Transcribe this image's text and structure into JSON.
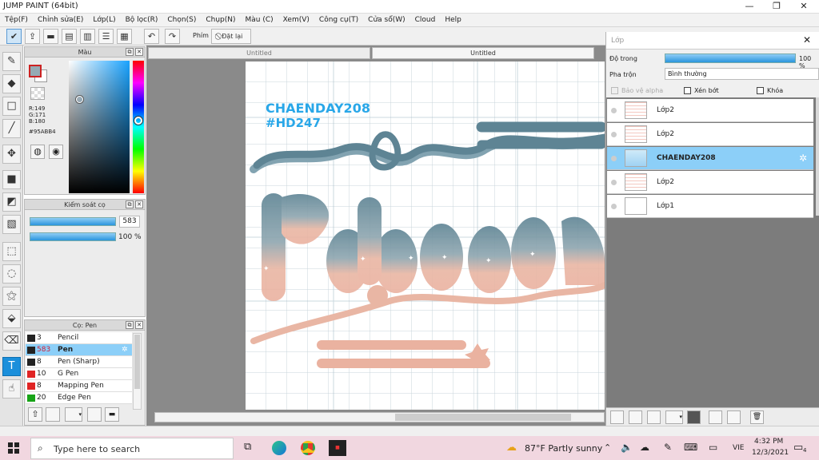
{
  "app": {
    "title": "JUMP PAINT (64bit)",
    "minimize": "—",
    "maximize": "❐",
    "close": "✕"
  },
  "menu": [
    "Tệp(F)",
    "Chỉnh sửa(E)",
    "Lớp(L)",
    "Bộ lọc(R)",
    "Chọn(S)",
    "Chụp(N)",
    "Màu (C)",
    "Xem(V)",
    "Công cụ(T)",
    "Cửa sổ(W)",
    "Cloud",
    "Help"
  ],
  "toolbar": {
    "pen_label": "Phím",
    "reset_label": "Đặt lại"
  },
  "color_panel": {
    "title": "Màu",
    "r": "R:149",
    "g": "G:171",
    "b": "B:180",
    "hex": "#95ABB4",
    "current_color": "#95abb4"
  },
  "brush_control": {
    "title": "Kiểm soát cọ",
    "size": "583",
    "opacity": "100 %",
    "size_fraction": 0.95,
    "opacity_fraction": 1.0
  },
  "brush_panel": {
    "title": "Cọ: Pen",
    "items": [
      {
        "size": "3",
        "name": "Pencil",
        "color": "#222222"
      },
      {
        "size": "583",
        "name": "Pen",
        "color": "#222222"
      },
      {
        "size": "8",
        "name": "Pen (Sharp)",
        "color": "#222222"
      },
      {
        "size": "10",
        "name": "G Pen",
        "color": "#e02424"
      },
      {
        "size": "8",
        "name": "Mapping Pen",
        "color": "#e02424"
      },
      {
        "size": "20",
        "name": "Edge Pen",
        "color": "#17a317"
      }
    ]
  },
  "tabs": [
    "Untitled",
    "Untitled"
  ],
  "canvas": {
    "line1": "CHAENDAY208",
    "line2": "#HD247"
  },
  "layers_panel": {
    "title": "Lớp",
    "opacity_label": "Độ trong",
    "opacity_value": "100 %",
    "blend_label": "Pha trộn",
    "blend_value": "Bình thường",
    "protect_alpha": "Bảo vệ alpha",
    "clip": "Xén bớt",
    "lock": "Khóa",
    "layers": [
      "Lớp2",
      "Lớp2",
      "CHAENDAY208",
      "Lớp2",
      "Lớp1"
    ]
  },
  "taskbar": {
    "search_placeholder": "Type here to search",
    "weather": "87°F  Partly sunny",
    "lang": "VIE",
    "time": "4:32 PM",
    "date": "12/3/2021",
    "notif": "4"
  }
}
